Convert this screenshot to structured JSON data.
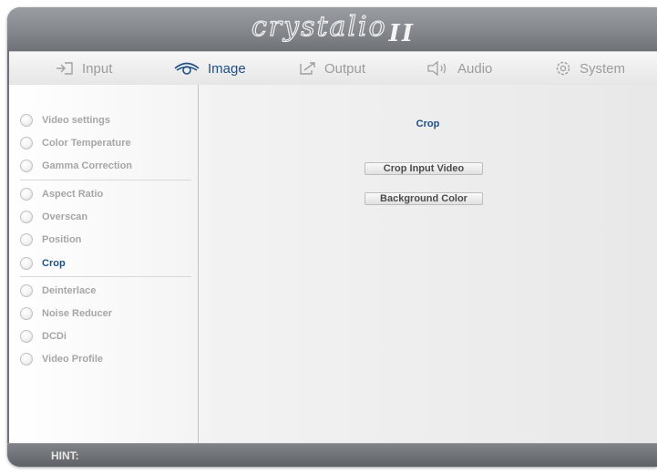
{
  "logo": {
    "text": "crystalio",
    "suffix": "II"
  },
  "tabs": [
    {
      "label": "Input",
      "icon": "input-icon"
    },
    {
      "label": "Image",
      "icon": "eye-icon"
    },
    {
      "label": "Output",
      "icon": "output-icon"
    },
    {
      "label": "Audio",
      "icon": "speaker-icon"
    },
    {
      "label": "System",
      "icon": "gear-icon"
    }
  ],
  "active_tab": "Image",
  "sidebar": {
    "items": [
      {
        "label": "Video settings"
      },
      {
        "label": "Color Temperature"
      },
      {
        "label": "Gamma Correction"
      },
      {
        "label": "Aspect Ratio"
      },
      {
        "label": "Overscan"
      },
      {
        "label": "Position"
      },
      {
        "label": "Crop"
      },
      {
        "label": "Deinterlace"
      },
      {
        "label": "Noise Reducer"
      },
      {
        "label": "DCDi"
      },
      {
        "label": "Video Profile"
      }
    ],
    "active_item": "Crop"
  },
  "main": {
    "title": "Crop",
    "buttons": [
      {
        "label": "Crop Input Video"
      },
      {
        "label": "Background Color"
      }
    ]
  },
  "hint": {
    "label": "HINT:"
  },
  "colors": {
    "accent": "#1e4f86",
    "inactive_text": "#a6a6a6",
    "frame": "#6f7377"
  }
}
